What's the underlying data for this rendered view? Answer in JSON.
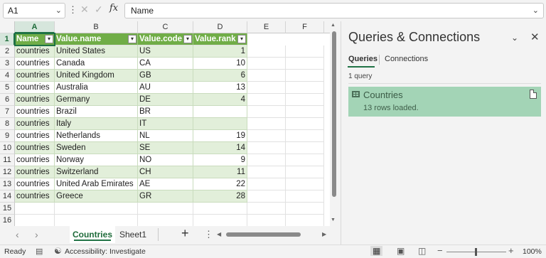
{
  "formula_bar": {
    "name_box": "A1",
    "formula": "Name"
  },
  "grid": {
    "columns": [
      "A",
      "B",
      "C",
      "D",
      "E",
      "F"
    ],
    "rows": [
      "1",
      "2",
      "3",
      "4",
      "5",
      "6",
      "7",
      "8",
      "9",
      "10",
      "11",
      "12",
      "13",
      "14",
      "15",
      "16"
    ],
    "table_headers": [
      "Name",
      "Value.name",
      "Value.code",
      "Value.rank"
    ],
    "table_rows": [
      [
        "countries",
        "United States",
        "US",
        "1"
      ],
      [
        "countries",
        "Canada",
        "CA",
        "10"
      ],
      [
        "countries",
        "United Kingdom",
        "GB",
        "6"
      ],
      [
        "countries",
        "Australia",
        "AU",
        "13"
      ],
      [
        "countries",
        "Germany",
        "DE",
        "4"
      ],
      [
        "countries",
        "Brazil",
        "BR",
        ""
      ],
      [
        "countries",
        "Italy",
        "IT",
        ""
      ],
      [
        "countries",
        "Netherlands",
        "NL",
        "19"
      ],
      [
        "countries",
        "Sweden",
        "SE",
        "14"
      ],
      [
        "countries",
        "Norway",
        "NO",
        "9"
      ],
      [
        "countries",
        "Switzerland",
        "CH",
        "11"
      ],
      [
        "countries",
        "United Arab Emirates",
        "AE",
        "22"
      ],
      [
        "countries",
        "Greece",
        "GR",
        "28"
      ]
    ],
    "colors": {
      "header": "#70ad47",
      "band": "#e2efda",
      "selection": "#217346"
    }
  },
  "sheet_tabs": {
    "active": "Countries",
    "other": "Sheet1",
    "add_icon": "plus-icon",
    "more_icon": "vertical-ellipsis-icon"
  },
  "status_bar": {
    "ready": "Ready",
    "accessibility": "Accessibility: Investigate",
    "zoom": "100%",
    "zoom_out": "−",
    "zoom_in": "+"
  },
  "queries_pane": {
    "title": "Queries & Connections",
    "tabs": [
      "Queries",
      "Connections"
    ],
    "count": "1 query",
    "items": [
      {
        "name": "Countries",
        "status": "13 rows loaded."
      }
    ],
    "accent": "#a3d4b6"
  }
}
